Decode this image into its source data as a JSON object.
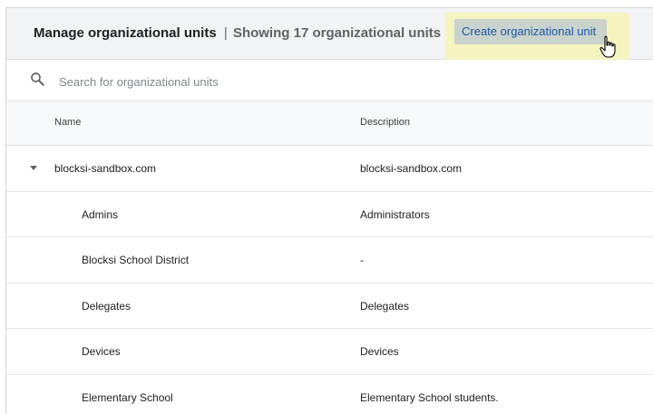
{
  "header": {
    "title": "Manage organizational units",
    "separator": "|",
    "subtitle": "Showing 17 organizational units",
    "create_button": "Create organizational unit"
  },
  "search": {
    "placeholder": "Search for organizational units",
    "value": ""
  },
  "table": {
    "columns": {
      "name": "Name",
      "description": "Description"
    },
    "rows": [
      {
        "name": "blocksi-sandbox.com",
        "description": "blocksi-sandbox.com",
        "level": 0,
        "expanded": true
      },
      {
        "name": "Admins",
        "description": "Administrators",
        "level": 1
      },
      {
        "name": "Blocksi School District",
        "description": "-",
        "level": 1
      },
      {
        "name": "Delegates",
        "description": "Delegates",
        "level": 1
      },
      {
        "name": "Devices",
        "description": "Devices",
        "level": 1
      },
      {
        "name": "Elementary School",
        "description": "Elementary School students.",
        "level": 1
      }
    ]
  },
  "icons": {
    "search": "search-icon",
    "expand": "caret-down-icon",
    "cursor": "hand-pointer-icon"
  },
  "colors": {
    "highlight": "#f6f4b8",
    "button_bg": "#c9d3cc",
    "button_text": "#1a56a8"
  }
}
